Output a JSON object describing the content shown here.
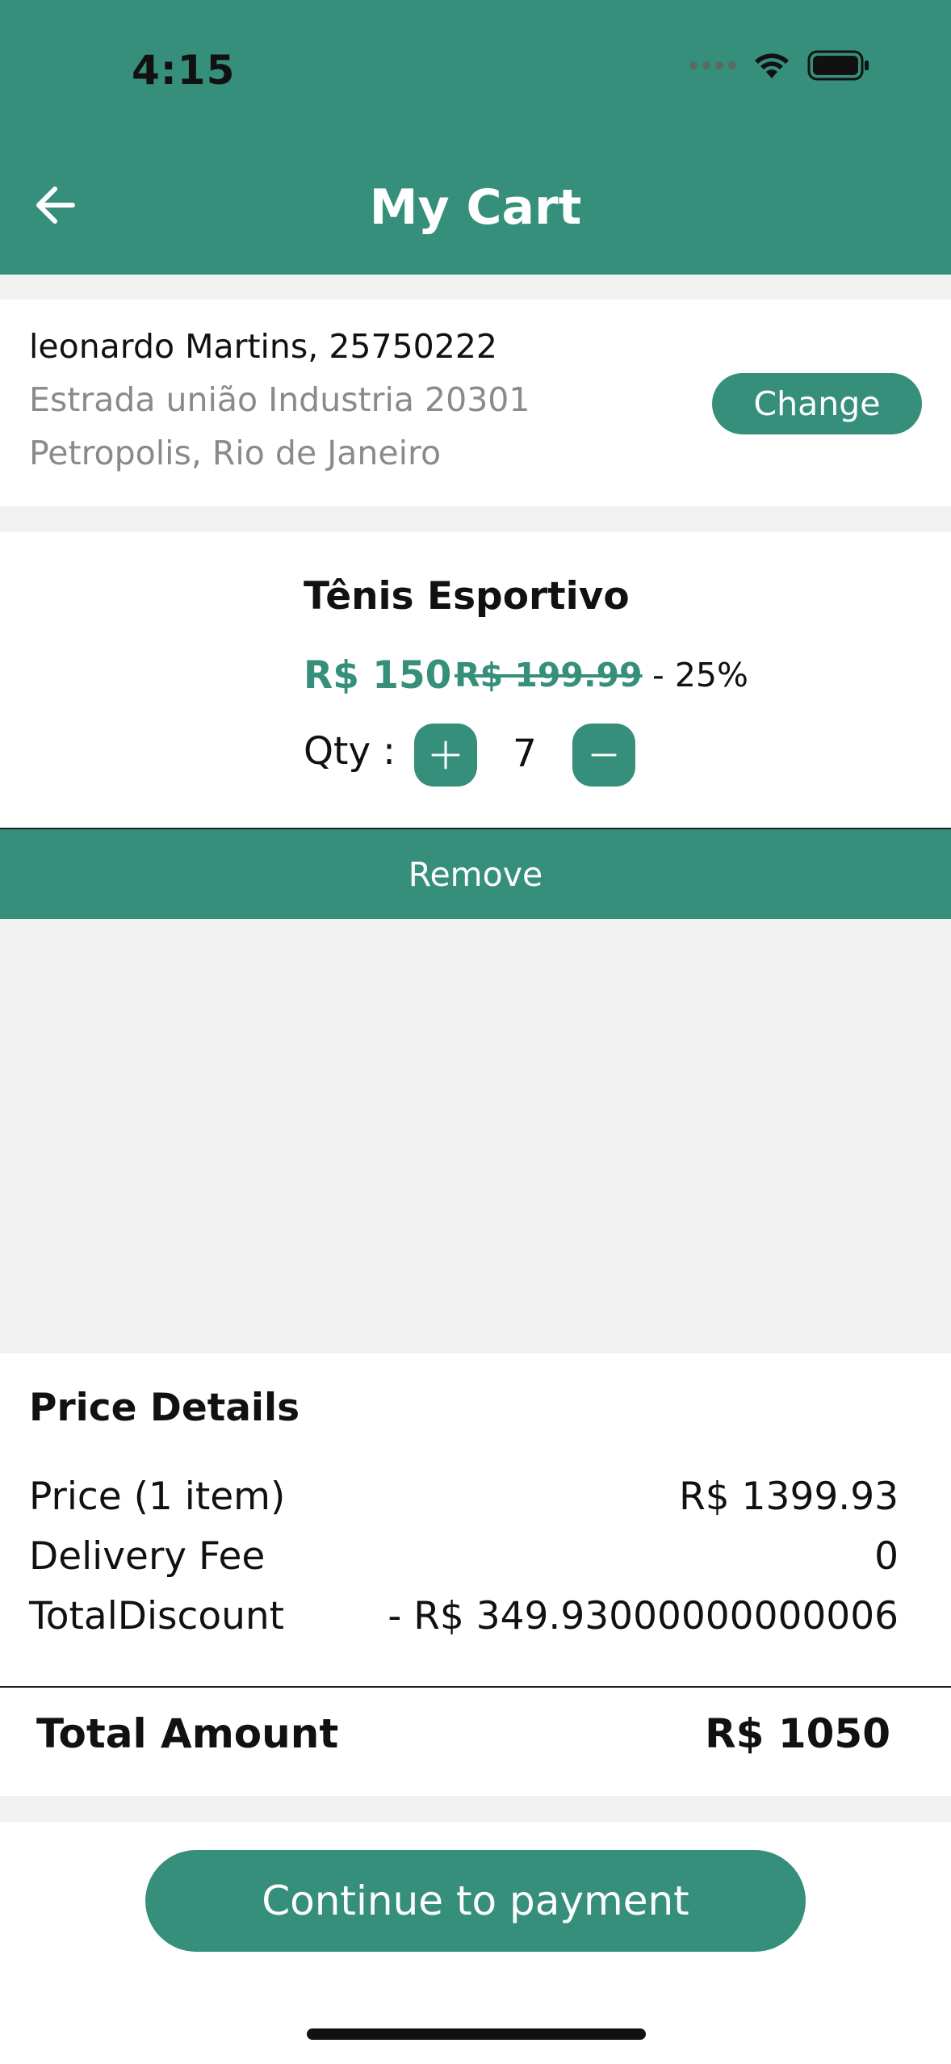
{
  "status_bar": {
    "time": "4:15",
    "icons": [
      "signal-dots-icon",
      "wifi-icon",
      "battery-icon"
    ]
  },
  "header": {
    "title": "My Cart",
    "back_icon": "arrow-left-icon"
  },
  "address": {
    "name_line": "leonardo Martins, 25750222",
    "street": "Estrada união Industria 20301",
    "city": "Petropolis, Rio de Janeiro",
    "change_label": "Change"
  },
  "cart_item": {
    "name": "Tênis Esportivo",
    "price": "R$ 150",
    "original_price": "R$ 199.99",
    "discount": "- 25%",
    "qty_label": "Qty :",
    "qty": "7",
    "remove_label": "Remove"
  },
  "price_details": {
    "title": "Price Details",
    "rows": [
      {
        "label": "Price (1 item)",
        "value": "R$ 1399.93"
      },
      {
        "label": "Delivery Fee",
        "value": "0"
      },
      {
        "label": "TotalDiscount",
        "value": "- R$ 349.93000000000006"
      }
    ],
    "total_label": "Total Amount",
    "total_value": "R$ 1050"
  },
  "footer": {
    "continue_label": "Continue to payment"
  },
  "colors": {
    "brand": "#358f7b",
    "background": "#f1f1f1",
    "muted_text": "#8a8a8a"
  }
}
